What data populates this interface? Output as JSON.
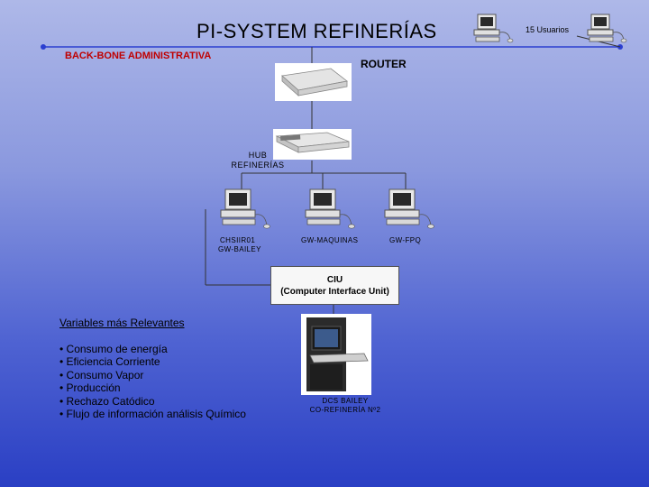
{
  "title": "PI-SYSTEM REFINERÍAS",
  "backbone": {
    "label": "BACK-BONE ADMINISTRATIVA"
  },
  "router": {
    "label": "ROUTER"
  },
  "users": {
    "label": "15 Usuarios"
  },
  "hub": {
    "label_line1": "HUB",
    "label_line2": "REFINERÍAS"
  },
  "workstations": [
    {
      "line1": "CHSIIR01",
      "line2": "GW-BAILEY"
    },
    {
      "line1": "GW-MAQUINAS",
      "line2": ""
    },
    {
      "line1": "GW-FPQ",
      "line2": ""
    }
  ],
  "ciu": {
    "line1": "CIU",
    "line2": "(Computer Interface Unit)"
  },
  "dcs": {
    "line1": "DCS BAILEY",
    "line2": "CO-REFINERÍA Nº2"
  },
  "variables": {
    "title": "Variables más Relevantes",
    "items": [
      "Consumo de energía",
      "Eficiencia Corriente",
      "Consumo Vapor",
      "Producción",
      "Rechazo Catódico",
      "Flujo de información análisis Químico"
    ]
  },
  "colors": {
    "backbone_line": "#2b3fd0",
    "backbone_label": "#c00000",
    "background_top": "#aeb8e8",
    "background_bottom": "#2a3fc4"
  }
}
